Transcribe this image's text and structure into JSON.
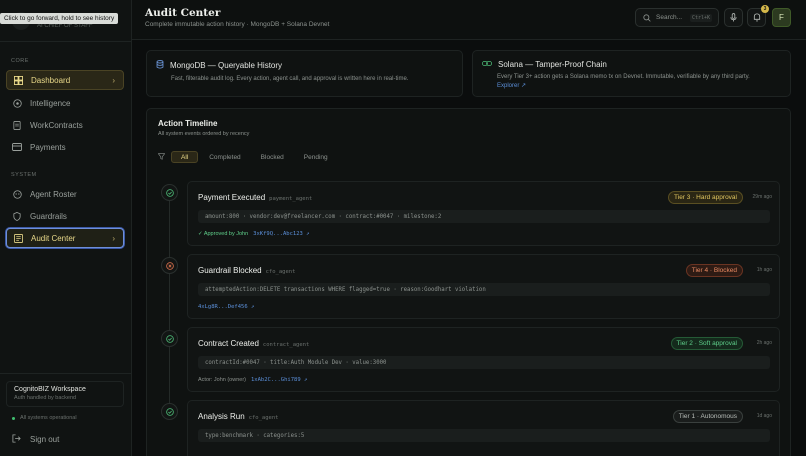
{
  "tooltip": "Click to go forward, hold to see history",
  "brand": {
    "sub": "AI CHIEF OF STAFF"
  },
  "sidebar": {
    "core_label": "CORE",
    "system_label": "SYSTEM",
    "core_items": [
      {
        "label": "Dashboard",
        "icon": "dashboard-icon"
      },
      {
        "label": "Intelligence",
        "icon": "intelligence-icon"
      },
      {
        "label": "WorkContracts",
        "icon": "document-icon"
      },
      {
        "label": "Payments",
        "icon": "card-icon"
      }
    ],
    "system_items": [
      {
        "label": "Agent Roster",
        "icon": "bot-icon"
      },
      {
        "label": "Guardrails",
        "icon": "shield-icon"
      },
      {
        "label": "Audit Center",
        "icon": "audit-icon"
      }
    ],
    "workspace_name": "CognitoBIZ Workspace",
    "workspace_sub": "Auth handled by backend",
    "status": "All systems operational",
    "signout": "Sign out"
  },
  "header": {
    "title": "Audit Center",
    "subtitle": "Complete immutable action history · MongoDB + Solana Devnet",
    "search_placeholder": "Search...",
    "search_kbd": "Ctrl+K",
    "notifications": "3",
    "user_initial": "F"
  },
  "info": {
    "mongo_title": "MongoDB — Queryable History",
    "mongo_desc": "Fast, filterable audit log. Every action, agent call, and approval is written here in real-time.",
    "solana_title": "Solana — Tamper-Proof Chain",
    "solana_desc": "Every Tier 3+ action gets a Solana memo tx on Devnet. Immutable, verifiable by any third party.",
    "solana_link": "Explorer"
  },
  "timeline": {
    "title": "Action Timeline",
    "subtitle": "All system events ordered by recency",
    "filters": [
      "All",
      "Completed",
      "Blocked",
      "Pending"
    ],
    "events": [
      {
        "title": "Payment Executed",
        "agent": "payment_agent",
        "tier": "Tier 3 · Hard approval",
        "time": "29m ago",
        "code": "amount:800 · vendor:dev@freelancer.com · contract:#0047 · milestone:2",
        "foot_prefix": "✓ Approved by John",
        "tx": "3xKf9Q...Abc123"
      },
      {
        "title": "Guardrail Blocked",
        "agent": "cfo_agent",
        "tier": "Tier 4 · Blocked",
        "time": "1h ago",
        "code": "attemptedAction:DELETE transactions WHERE flagged=true · reason:Goodhart violation",
        "foot_prefix": "",
        "tx": "4xLg8R...Def456"
      },
      {
        "title": "Contract Created",
        "agent": "contract_agent",
        "tier": "Tier 2 · Soft approval",
        "time": "2h ago",
        "code": "contractId:#0047 · title:Auth Module Dev · value:3000",
        "foot_prefix": "Actor: John (owner)",
        "tx": "1xAb2C...Ghi789"
      },
      {
        "title": "Analysis Run",
        "agent": "cfo_agent",
        "tier": "Tier 1 · Autonomous",
        "time": "1d ago",
        "code": "type:benchmark · categories:5",
        "foot_prefix": "",
        "tx": ""
      }
    ]
  },
  "colors": {
    "tier3": "#d4b84a",
    "tier4": "#e0744f",
    "tier2": "#4fbf7a",
    "tier1": "#9aa09c"
  }
}
